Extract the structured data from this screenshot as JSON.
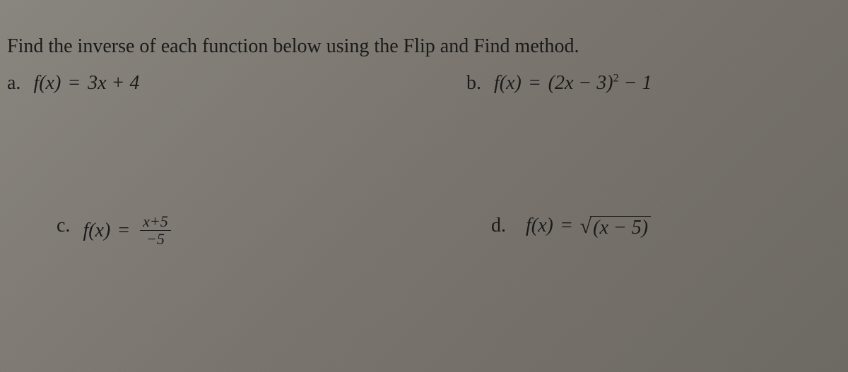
{
  "prompt": "Find the inverse of each function below using the Flip and Find method.",
  "problems": {
    "a": {
      "label": "a.",
      "lhs": "f(x)",
      "eq": "=",
      "rhs": "3x + 4"
    },
    "b": {
      "label": "b.",
      "lhs": "f(x)",
      "eq": "=",
      "rhs_pre": "(2x − 3)",
      "exp": "2",
      "rhs_post": " − 1"
    },
    "c": {
      "label": "c.",
      "lhs": "f(x)",
      "eq": "=",
      "frac_num": "x+5",
      "frac_den": "−5"
    },
    "d": {
      "label": "d.",
      "lhs": "f(x)",
      "eq": "=",
      "sqrt_body": "(x − 5)"
    }
  }
}
